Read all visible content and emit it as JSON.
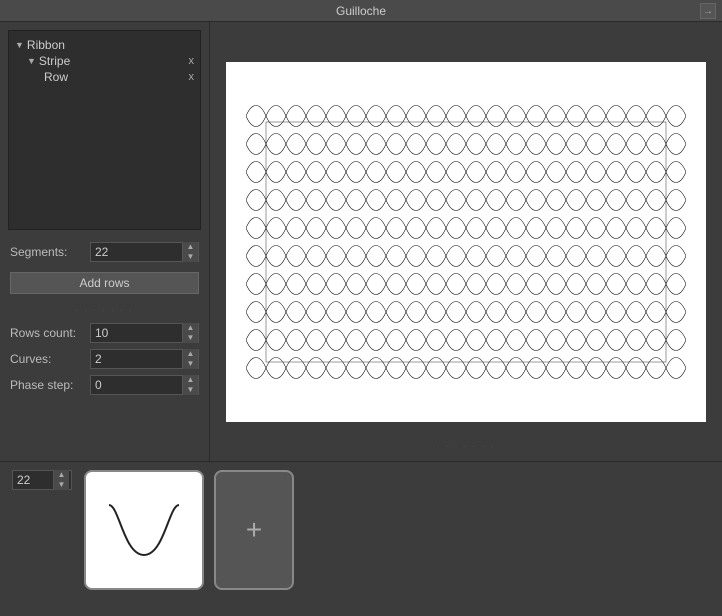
{
  "app": {
    "title": "Guilloche",
    "pin_icon": "→"
  },
  "tree": {
    "items": [
      {
        "level": 0,
        "arrow": "▼",
        "label": "Ribbon",
        "has_close": false
      },
      {
        "level": 1,
        "arrow": "▼",
        "label": "Stripe",
        "has_close": true,
        "close": "x"
      },
      {
        "level": 2,
        "arrow": "",
        "label": "Row",
        "has_close": true,
        "close": "x"
      }
    ]
  },
  "controls": {
    "segments_label": "Segments:",
    "segments_value": "22",
    "add_rows_label": "Add rows",
    "rows_count_label": "Rows count:",
    "rows_count_value": "10",
    "curves_label": "Curves:",
    "curves_value": "2",
    "phase_step_label": "Phase step:",
    "phase_step_value": "0"
  },
  "bottom": {
    "spinbox_value": "22",
    "add_icon": "+"
  }
}
